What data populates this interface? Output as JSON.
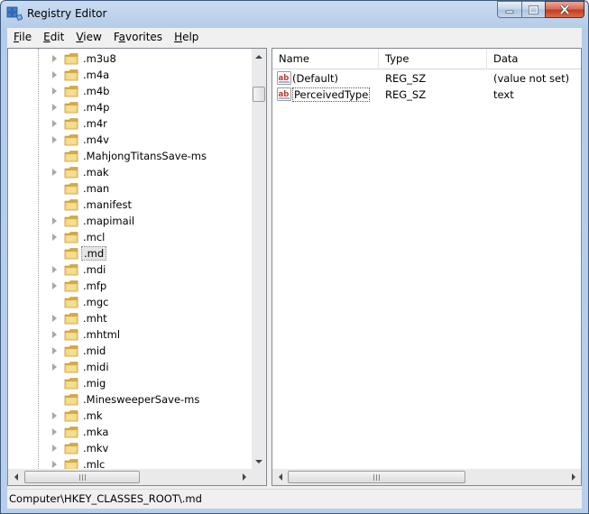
{
  "window": {
    "title": "Registry Editor"
  },
  "menu": [
    {
      "key": "F",
      "rest": "ile"
    },
    {
      "key": "E",
      "rest": "dit"
    },
    {
      "key": "V",
      "rest": "iew"
    },
    {
      "key": "",
      "rest": "Favorites",
      "underline_index": 1
    },
    {
      "key": "H",
      "rest": "elp"
    }
  ],
  "menu_labels": {
    "file_key": "F",
    "file_rest": "ile",
    "edit_key": "E",
    "edit_rest": "dit",
    "view_key": "V",
    "view_rest": "iew",
    "fav_pre": "F",
    "fav_key": "a",
    "fav_rest": "vorites",
    "help_key": "H",
    "help_rest": "elp"
  },
  "tree": {
    "items": [
      {
        "label": ".m3u8",
        "expandable": true
      },
      {
        "label": ".m4a",
        "expandable": true
      },
      {
        "label": ".m4b",
        "expandable": true
      },
      {
        "label": ".m4p",
        "expandable": true
      },
      {
        "label": ".m4r",
        "expandable": true
      },
      {
        "label": ".m4v",
        "expandable": true
      },
      {
        "label": ".MahjongTitansSave-ms",
        "expandable": false
      },
      {
        "label": ".mak",
        "expandable": true
      },
      {
        "label": ".man",
        "expandable": false
      },
      {
        "label": ".manifest",
        "expandable": false
      },
      {
        "label": ".mapimail",
        "expandable": true
      },
      {
        "label": ".mcl",
        "expandable": true
      },
      {
        "label": ".md",
        "expandable": false,
        "selected": true
      },
      {
        "label": ".mdi",
        "expandable": true
      },
      {
        "label": ".mfp",
        "expandable": true
      },
      {
        "label": ".mgc",
        "expandable": false
      },
      {
        "label": ".mht",
        "expandable": true
      },
      {
        "label": ".mhtml",
        "expandable": true
      },
      {
        "label": ".mid",
        "expandable": true
      },
      {
        "label": ".midi",
        "expandable": true
      },
      {
        "label": ".mig",
        "expandable": false
      },
      {
        "label": ".MinesweeperSave-ms",
        "expandable": false
      },
      {
        "label": ".mk",
        "expandable": true
      },
      {
        "label": ".mka",
        "expandable": true
      },
      {
        "label": ".mkv",
        "expandable": true
      },
      {
        "label": ".mlc",
        "expandable": true
      }
    ]
  },
  "list": {
    "columns": [
      "Name",
      "Type",
      "Data"
    ],
    "rows": [
      {
        "name": "(Default)",
        "type": "REG_SZ",
        "data": "(value not set)",
        "icon": "string-value-icon"
      },
      {
        "name": "PerceivedType",
        "type": "REG_SZ",
        "data": "text",
        "icon": "string-value-icon",
        "focused": true
      }
    ]
  },
  "status": {
    "path": "Computer\\HKEY_CLASSES_ROOT\\.md"
  },
  "colors": {
    "folder": "#e8c35a",
    "selection": "#e5e5e5",
    "frame": "#b9cfe9",
    "close_button": "#c2391d"
  }
}
